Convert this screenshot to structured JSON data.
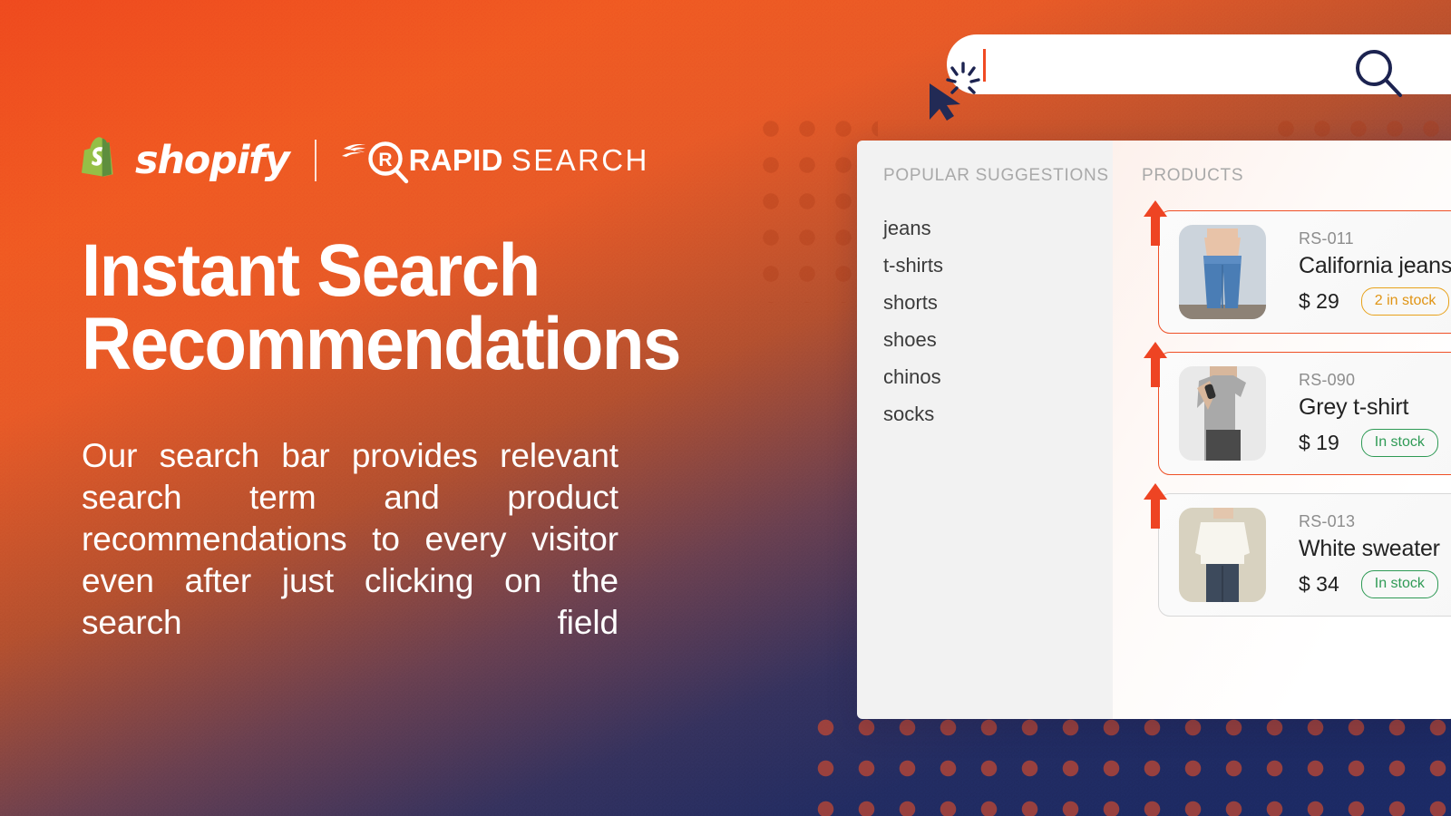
{
  "brand": {
    "shopify_label": "shopify",
    "divider": "|",
    "rapid_label": "RAPID",
    "search_label": "SEARCH",
    "shopify_bag_icon": "shopify-bag-icon",
    "rapid_mark_icon": "rapid-magnifier-r-icon"
  },
  "hero": {
    "headline": "Instant Search Recommendations",
    "subcopy": "Our search bar provides relevant search term and product recommendations to every visitor even after just clicking on the search field"
  },
  "search": {
    "value": "",
    "placeholder": "",
    "magnifier_icon": "search-icon",
    "cursor_icon": "mouse-pointer-click-icon",
    "caret_color": "#f04a23"
  },
  "panel": {
    "suggestions": {
      "title": "POPULAR SUGGESTIONS",
      "items": [
        {
          "label": "jeans"
        },
        {
          "label": "t-shirts"
        },
        {
          "label": "shorts"
        },
        {
          "label": "shoes"
        },
        {
          "label": "chinos"
        },
        {
          "label": "socks"
        }
      ]
    },
    "products": {
      "title": "PRODUCTS",
      "items": [
        {
          "sku": "RS-011",
          "name": "California jeans",
          "price": "$ 29",
          "stock": "2 in stock",
          "stock_state": "low",
          "thumb_icon": "product-thumb-jeans",
          "highlight": true
        },
        {
          "sku": "RS-090",
          "name": "Grey t-shirt",
          "price": "$ 19",
          "stock": "In stock",
          "stock_state": "ok",
          "thumb_icon": "product-thumb-tshirt",
          "highlight": true
        },
        {
          "sku": "RS-013",
          "name": "White sweater",
          "price": "$ 34",
          "stock": "In stock",
          "stock_state": "ok",
          "thumb_icon": "product-thumb-sweater",
          "highlight": false
        }
      ]
    }
  },
  "colors": {
    "orange": "#f05a22",
    "red_orange": "#ef4a1e",
    "navy": "#1d2a63",
    "accent_card_border": "#ef5026",
    "badge_ok": "#2e9a55",
    "badge_warn": "#e09414"
  }
}
